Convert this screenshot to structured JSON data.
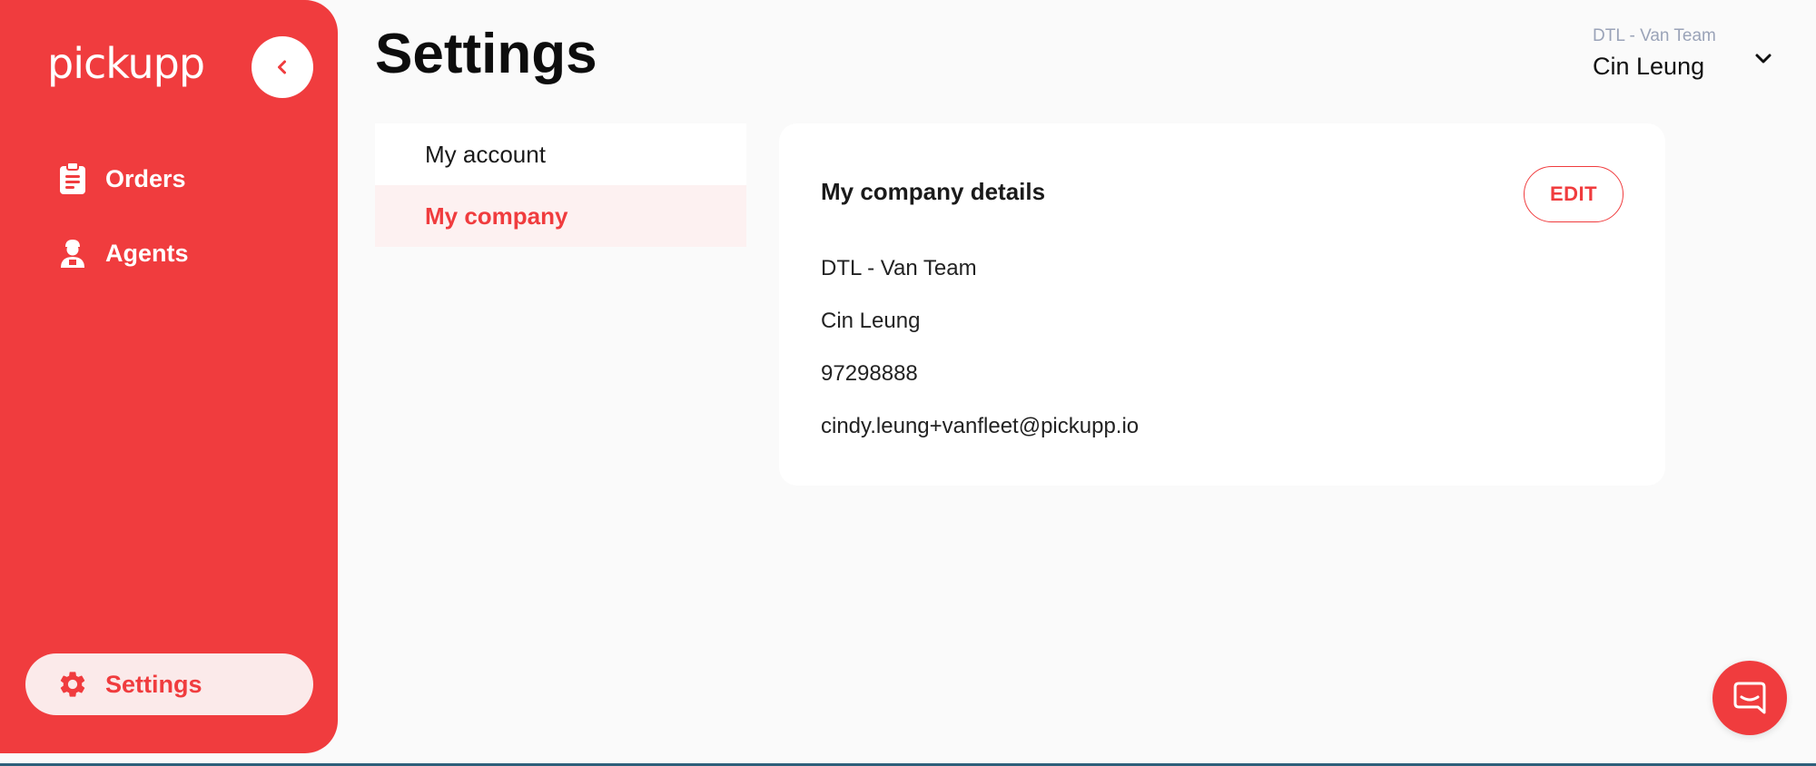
{
  "sidebar": {
    "logo_text": "pickupp",
    "items": [
      {
        "label": "Orders",
        "icon": "clipboard-icon"
      },
      {
        "label": "Agents",
        "icon": "agent-icon"
      }
    ],
    "settings": {
      "label": "Settings",
      "icon": "gear-icon"
    }
  },
  "header": {
    "title": "Settings",
    "user": {
      "company": "DTL - Van Team",
      "name": "Cin Leung"
    }
  },
  "submenu": {
    "items": [
      {
        "label": "My account"
      },
      {
        "label": "My company"
      }
    ]
  },
  "card": {
    "title": "My company details",
    "edit_label": "EDIT",
    "company_name": "DTL - Van Team",
    "contact_name": "Cin Leung",
    "phone": "97298888",
    "email": "cindy.leung+vanfleet@pickupp.io"
  },
  "colors": {
    "brand": "#f03c3e",
    "muted": "#9aa3b8",
    "background": "#fafafa"
  }
}
